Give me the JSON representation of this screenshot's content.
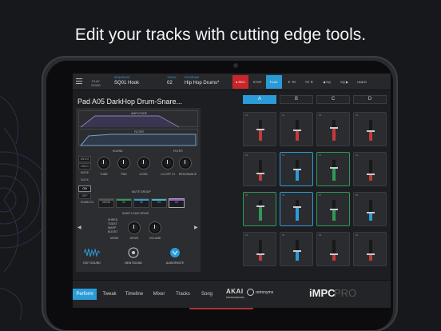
{
  "headline": "Edit your tracks with cutting edge tools.",
  "topbar": {
    "play_song_label": "PLAY SONG",
    "sequence_caption": "SEQUENCE",
    "sequence_value": "SQ01 Hook",
    "track_caption": "TRACK",
    "track_value": "02",
    "program_caption": "PROGRAM",
    "program_value": "Hip Hop Drums*",
    "buttons": [
      "● REC",
      "STOP",
      "PLAY",
      "▼ TR",
      "TR ▼",
      "◀ SQ",
      "SQ ▶",
      "UNDO"
    ]
  },
  "pad": {
    "title": "Pad A05  DarkHop Drum-Snare...",
    "banks": [
      "A",
      "B",
      "C",
      "D"
    ],
    "active_bank": "A"
  },
  "panel": {
    "amplitude_label": "AMPLITUDE",
    "filter_env_label": "FILTER",
    "sound_label": "SOUND",
    "filter_label": "FILTER",
    "side_buttons": [
      "1SHOT",
      "HOLD",
      "MODE",
      "DUCK",
      "ON",
      "OFF",
      "ENABLED"
    ],
    "knobs": [
      "TUNE",
      "PAN",
      "LEVEL",
      "LO-OFF /H",
      "RESONANCE"
    ],
    "mute_group_label": "MUTE GROUP",
    "mute_cells": [
      "NONE",
      "01",
      "02",
      "03",
      "04"
    ],
    "drive_label": "SAINT LOUIS DRIVE",
    "drive_options": [
      "SHRED",
      "TOAST",
      "WARP",
      "BOOST"
    ],
    "mode_label": "MODE",
    "drive_knob": "DRIVE",
    "volume_knob": "VOLUME",
    "tools": [
      "EDIT SOUND",
      "NEW SOUND",
      "AUDIOPASTE"
    ]
  },
  "pads": [
    {
      "num": "13",
      "level": 0.55,
      "color": "#c43a3a",
      "border": "#3a3b40"
    },
    {
      "num": "14",
      "level": 0.5,
      "color": "#c43a3a",
      "border": "#3a3b40"
    },
    {
      "num": "15",
      "level": 0.6,
      "color": "#c43a3a",
      "border": "#3a3b40"
    },
    {
      "num": "16",
      "level": 0.45,
      "color": "#c43a3a",
      "border": "#3a3b40"
    },
    {
      "num": "09",
      "level": 0.35,
      "color": "#c43a3a",
      "border": "#3a3b40"
    },
    {
      "num": "10",
      "level": 0.55,
      "color": "#2b9cd8",
      "border": "#2b9cd8"
    },
    {
      "num": "11",
      "level": 0.6,
      "color": "#2f9a55",
      "border": "#2f9a55"
    },
    {
      "num": "12",
      "level": 0.3,
      "color": "#c43a3a",
      "border": "#3a3b40"
    },
    {
      "num": "05",
      "level": 0.7,
      "color": "#2f9a55",
      "border": "#2f9a55"
    },
    {
      "num": "06",
      "level": 0.65,
      "color": "#2b9cd8",
      "border": "#2b9cd8"
    },
    {
      "num": "07",
      "level": 0.55,
      "color": "#2f9a55",
      "border": "#2f9a55"
    },
    {
      "num": "08",
      "level": 0.4,
      "color": "#2b9cd8",
      "border": "#3a3b40"
    },
    {
      "num": "01",
      "level": 0.3,
      "color": "#c43a3a",
      "border": "#3a3b40"
    },
    {
      "num": "02",
      "level": 0.45,
      "color": "#2b9cd8",
      "border": "#3a3b40"
    },
    {
      "num": "03",
      "level": 0.3,
      "color": "#c43a3a",
      "border": "#3a3b40"
    },
    {
      "num": "04",
      "level": 0.3,
      "color": "#c43a3a",
      "border": "#3a3b40"
    }
  ],
  "tabs": [
    "Perform",
    "Tweak",
    "Timeline",
    "Mixer",
    "Tracks",
    "Song"
  ],
  "active_tab": "Perform",
  "brand": {
    "akai": "AKAI",
    "akai_sub": "PROFESSIONAL",
    "retronyms": "retronyms",
    "impc_a": "iMPC",
    "impc_b": "PRO"
  },
  "colors": {
    "accent": "#2b9cd8",
    "rec": "#c8262a",
    "green": "#2f9a55"
  }
}
